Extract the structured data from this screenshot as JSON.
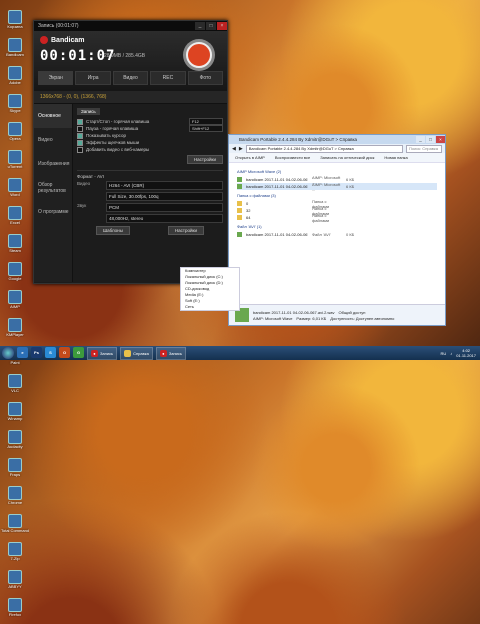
{
  "desktop_icons": [
    "Корзина",
    "Bandicam",
    "Adobe",
    "Skype",
    "Opera",
    "uTorrent",
    "Word",
    "Excel",
    "Steam",
    "Google",
    "AIMP",
    "KMPlayer",
    "Paint",
    "VLC",
    "Winamp",
    "Audacity",
    "Fraps",
    "Chrome",
    "Total Commander",
    "7-Zip",
    "ABBYY",
    "Firefox"
  ],
  "bandicam": {
    "title": "Запись (00:01:07)",
    "app_name": "Bandicam",
    "timer": "00:01:07",
    "size": "28.9MB / 285.4GB",
    "toolbar": [
      "Экран",
      "Игра",
      "Видео",
      "REC",
      "Фото"
    ],
    "mode": "1366x768 - (0, 0), (1366, 768)",
    "sidebar": [
      "Основное",
      "Видео",
      "Изображения",
      "Обзор результатов",
      "О программе"
    ],
    "tab_record": "Запись",
    "options": [
      {
        "label": "Старт/Стоп - горячая клавиша",
        "on": true,
        "key": "F12"
      },
      {
        "label": "Пауза - горячая клавиша",
        "on": false,
        "key": "Shift+F12"
      },
      {
        "label": "Показывать курсор",
        "on": true,
        "key": ""
      },
      {
        "label": "Эффекты щелчков мыши",
        "on": true,
        "key": ""
      },
      {
        "label": "Добавить видео с веб-камеры",
        "on": false,
        "key": ""
      }
    ],
    "settings_button": "Настройки",
    "format_label": "Формат",
    "format_value": "AVI",
    "format_rows": [
      {
        "key": "Видео",
        "v1": "H264 - AVI (CBR)",
        "v2": "Full Size, 30.00fps, 100q"
      },
      {
        "key": "Звук",
        "v1": "PCM",
        "v2": "48,000Hz, stereo"
      }
    ],
    "presets_button": "Шаблоны",
    "settings2_button": "Настройки"
  },
  "explorer": {
    "title": "Bandicam Portable 2.4.4.284 By Xdmitr@DGuT > Справка",
    "address": "Bandicam Portable 2.4.4.284 By Xdmitr@DGuT > Справка",
    "search_placeholder": "Поиск: Справка",
    "commands": [
      "Открыть в AIMP",
      "Воспроизвести все",
      "Записать на оптический диск",
      "Новая папка"
    ],
    "group_wave": "AIMP Microsoft Wave (2)",
    "files_wave": [
      {
        "name": "bandicam 2017-11-01 04-02-06-067.avi.2.wav",
        "type": "AIMP: Microsoft ...",
        "size": "6 КБ"
      },
      {
        "name": "bandicam 2017-11-01 04-02-06-067.avi.2.wav",
        "type": "AIMP: Microsoft ...",
        "size": "6 КБ"
      }
    ],
    "group_folders": "Папка с файлами (3)",
    "folders": [
      {
        "name": "0",
        "type": "Папка с файлами",
        "size": ""
      },
      {
        "name": "32",
        "type": "Папка с файлами",
        "size": ""
      },
      {
        "name": "64",
        "type": "Папка с файлами",
        "size": ""
      }
    ],
    "group_avi": "Файл 'AVI' (1)",
    "files_avi": [
      {
        "name": "bandicam 2017-11-01 04-02-06-067.avi",
        "type": "Файл 'AVI'",
        "size": "0 КБ"
      }
    ],
    "tree": [
      "Компьютер",
      "Локальный диск (C:)",
      "Локальный диск (D:)",
      "CD-дисковод",
      "Media (E:)",
      "Soft (E:)",
      "Сеть"
    ],
    "status_name": "bandicam 2017-11-01 04-02-06-067.avi.2.wav",
    "status_type": "AIMP: Microsoft Wave",
    "status_size": "Размер: 6,01 КБ",
    "status_shared": "Общий доступ",
    "status_availability": "Доступность: Доступен автономно"
  },
  "taskbar": {
    "items": [
      {
        "label": "",
        "color": "#2b6fb6",
        "glyph": "e"
      },
      {
        "label": "",
        "color": "#1a3a6e",
        "glyph": "Ps"
      },
      {
        "label": "",
        "color": "#2a8bd6",
        "glyph": "S"
      },
      {
        "label": "",
        "color": "#c24a1a",
        "glyph": "O"
      },
      {
        "label": "",
        "color": "#3c9a3c",
        "glyph": "G"
      },
      {
        "label": "Запись",
        "color": "#c22",
        "glyph": "●"
      },
      {
        "label": "Справка",
        "color": "#e8c04a",
        "glyph": ""
      },
      {
        "label": "Запись",
        "color": "#c22",
        "glyph": "●"
      }
    ],
    "lang": "RU",
    "time": "4:02",
    "date": "01.11.2017"
  }
}
